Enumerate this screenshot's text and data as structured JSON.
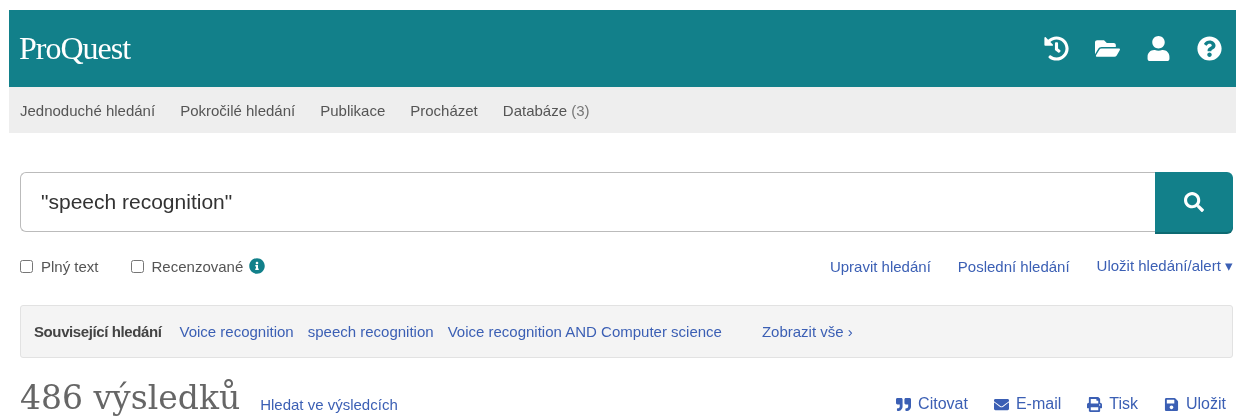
{
  "header": {
    "logo": "ProQuest"
  },
  "nav": [
    {
      "label": "Jednoduché hledání"
    },
    {
      "label": "Pokročilé hledání"
    },
    {
      "label": "Publikace"
    },
    {
      "label": "Procházet"
    },
    {
      "label": "Databáze",
      "count": "(3)"
    }
  ],
  "search": {
    "value": "\"speech recognition\""
  },
  "filters": [
    {
      "label": "Plný text",
      "checked": false,
      "info": false
    },
    {
      "label": "Recenzované",
      "checked": false,
      "info": true
    }
  ],
  "search_links": [
    "Upravit hledání",
    "Poslední hledání",
    "Uložit hledání/alert ▾"
  ],
  "related": {
    "label": "Související hledání",
    "links": [
      "Voice recognition",
      "speech recognition",
      "Voice recognition AND Computer science"
    ],
    "show_all": "Zobrazit vše ›"
  },
  "results": {
    "count": "486 výsledků",
    "search_within": "Hledat ve výsledcích"
  },
  "actions": [
    "Citovat",
    "E-mail",
    "Tisk",
    "Uložit"
  ]
}
